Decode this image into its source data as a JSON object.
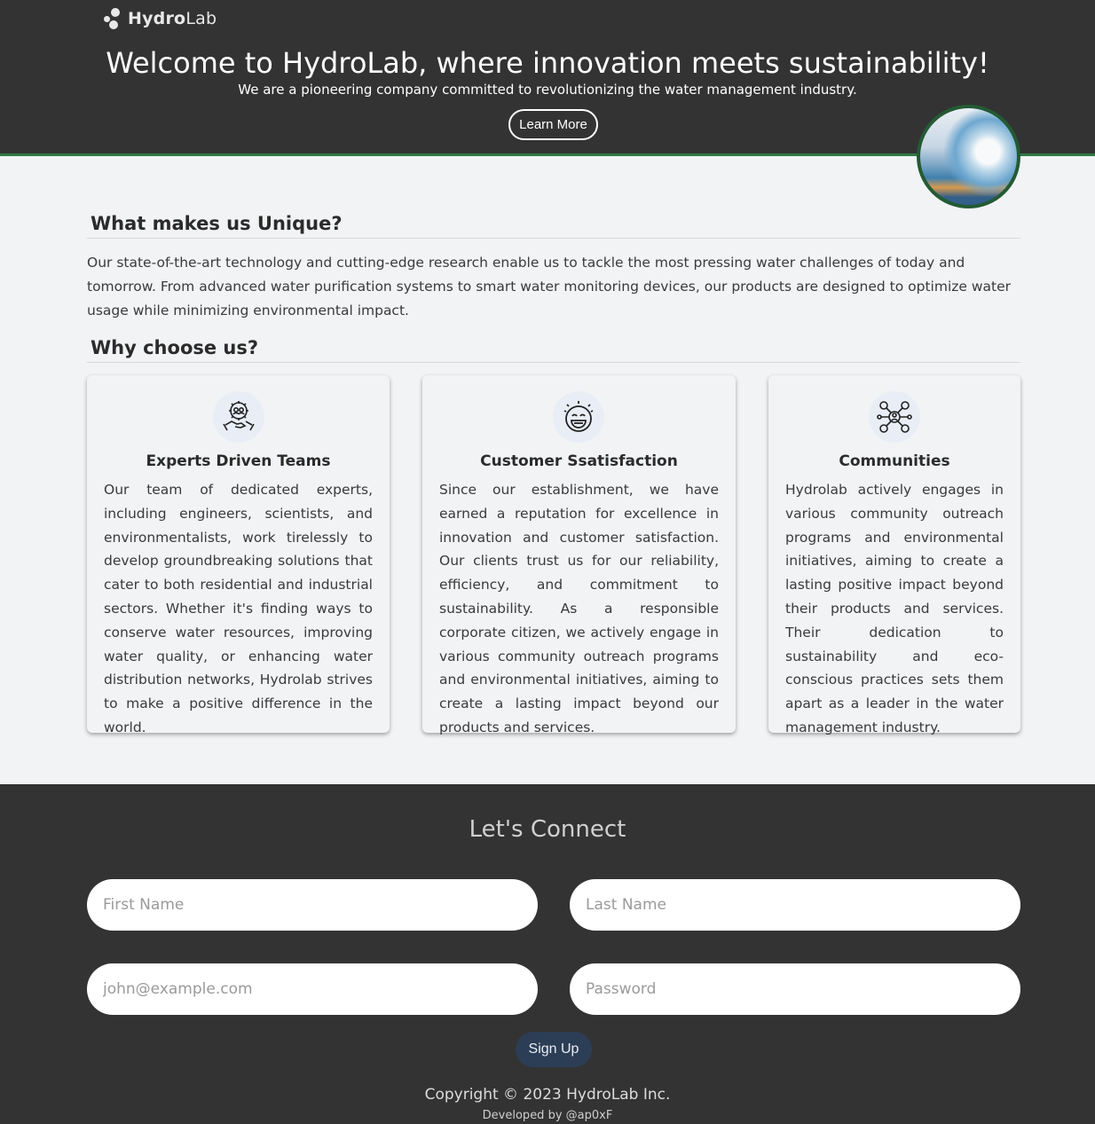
{
  "brand": {
    "name_bold": "Hydro",
    "name_light": "Lab"
  },
  "hero": {
    "title": "Welcome to HydroLab, where innovation meets sustainability!",
    "subtitle": "We are a pioneering company committed to revolutionizing the water management industry.",
    "cta_label": "Learn More"
  },
  "unique": {
    "title": "What makes us Unique?",
    "text": "Our state-of-the-art technology and cutting-edge research enable us to tackle the most pressing water challenges of today and tomorrow. From advanced water purification systems to smart water monitoring devices, our products are designed to optimize water usage while minimizing environmental impact."
  },
  "why": {
    "title": "Why choose us?",
    "cards": [
      {
        "icon": "team-gear-icon",
        "title": "Experts Driven Teams",
        "text": "Our team of dedicated experts, including engineers, scientists, and environmentalists, work tirelessly to develop groundbreaking solutions that cater to both residential and industrial sectors. Whether it's finding ways to conserve water resources, improving water quality, or enhancing water distribution networks, Hydrolab strives to make a positive difference in the world."
      },
      {
        "icon": "smiley-face-icon",
        "title": "Customer Ssatisfaction",
        "text": "Since our establishment, we have earned a reputation for excellence in innovation and customer satisfaction. Our clients trust us for our reliability, efficiency, and commitment to sustainability. As a responsible corporate citizen, we actively engage in various community outreach programs and environmental initiatives, aiming to create a lasting impact beyond our products and services."
      },
      {
        "icon": "community-network-icon",
        "title": "Communities",
        "text": "Hydrolab actively engages in various community outreach programs and environmental initiatives, aiming to create a lasting positive impact beyond their products and services. Their dedication to sustainability and eco-conscious practices sets them apart as a leader in the water management industry."
      }
    ]
  },
  "connect": {
    "title": "Let's Connect",
    "first_name_placeholder": "First Name",
    "last_name_placeholder": "Last Name",
    "email_placeholder": "john@example.com",
    "password_placeholder": "Password",
    "signup_label": "Sign Up"
  },
  "footer": {
    "copyright": "Copyright © 2023 HydroLab Inc.",
    "developed": "Developed by @ap0xF"
  },
  "colors": {
    "header_bg": "#333333",
    "accent_green": "#2f7a43",
    "signup_bg": "#2c3e56"
  }
}
